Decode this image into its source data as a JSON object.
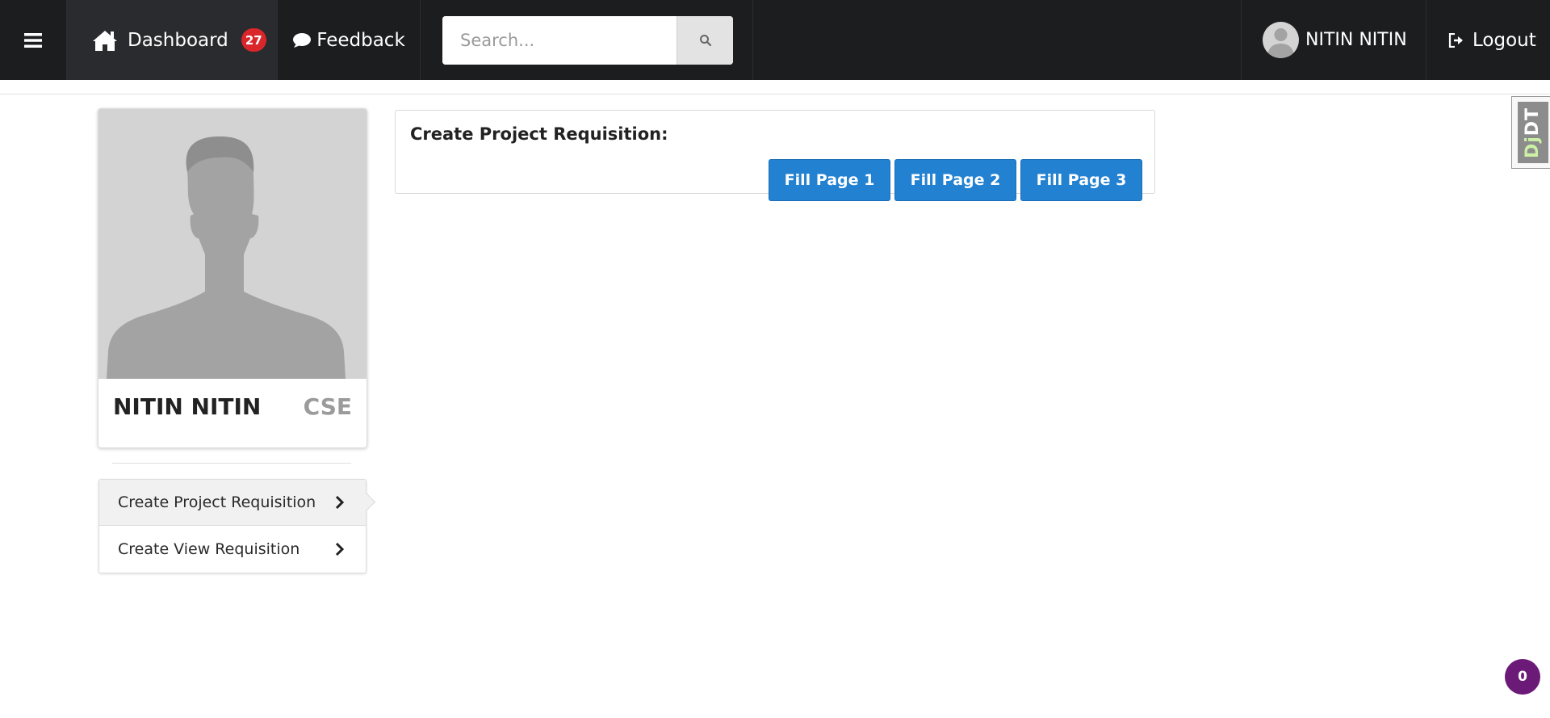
{
  "navbar": {
    "menu_icon": "hamburger-icon",
    "dashboard": {
      "label": "Dashboard",
      "icon": "home-icon",
      "badge": "27"
    },
    "feedback": {
      "label": "Feedback",
      "icon": "comment-icon"
    },
    "search": {
      "placeholder": "Search...",
      "value": "",
      "icon": "search-icon"
    },
    "user": {
      "name": "NITIN NITIN",
      "icon": "avatar"
    },
    "logout": {
      "label": "Logout",
      "icon": "sign-out-icon"
    }
  },
  "profile": {
    "name": "NITIN NITIN",
    "department": "CSE"
  },
  "sidebar": {
    "items": [
      {
        "label": "Create Project Requisition",
        "active": true,
        "icon": "chevron-right-icon"
      },
      {
        "label": "Create View Requisition",
        "active": false,
        "icon": "chevron-right-icon"
      }
    ]
  },
  "panel": {
    "title": "Create Project Requisition:",
    "buttons": [
      {
        "label": "Fill Page 1"
      },
      {
        "label": "Fill Page 2"
      },
      {
        "label": "Fill Page 3"
      }
    ]
  },
  "djdt": {
    "prefix": "Dj",
    "suffix": "DT"
  },
  "counter": {
    "value": "0"
  },
  "colors": {
    "navbar_bg": "#1c1d1f",
    "badge": "#d9262b",
    "primary_button": "#2281d1",
    "counter_bg": "#6c1a78"
  }
}
